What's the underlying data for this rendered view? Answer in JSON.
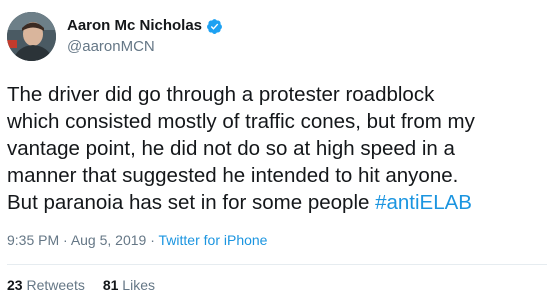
{
  "author": {
    "display_name": "Aaron Mc Nicholas",
    "handle": "@aaronMCN",
    "verified": true,
    "verified_icon": "verified-badge-icon"
  },
  "tweet": {
    "lines": [
      "The driver did go through a protester roadblock",
      "which consisted mostly of traffic cones, but from my",
      "vantage point, he did not do so at high speed in a",
      "manner that suggested he intended to hit anyone.",
      "But paranoia has set in for some people "
    ],
    "hashtag": "#antiELAB"
  },
  "meta": {
    "time": "9:35 PM",
    "separator1": " · ",
    "date": "Aug 5, 2019",
    "separator2": " · ",
    "source": "Twitter for iPhone"
  },
  "stats": {
    "retweets_count": "23",
    "retweets_label": "Retweets",
    "likes_count": "81",
    "likes_label": "Likes"
  },
  "colors": {
    "link": "#1b95e0",
    "secondary_text": "#657786",
    "primary_text": "#14171a",
    "verified": "#1da1f2"
  }
}
